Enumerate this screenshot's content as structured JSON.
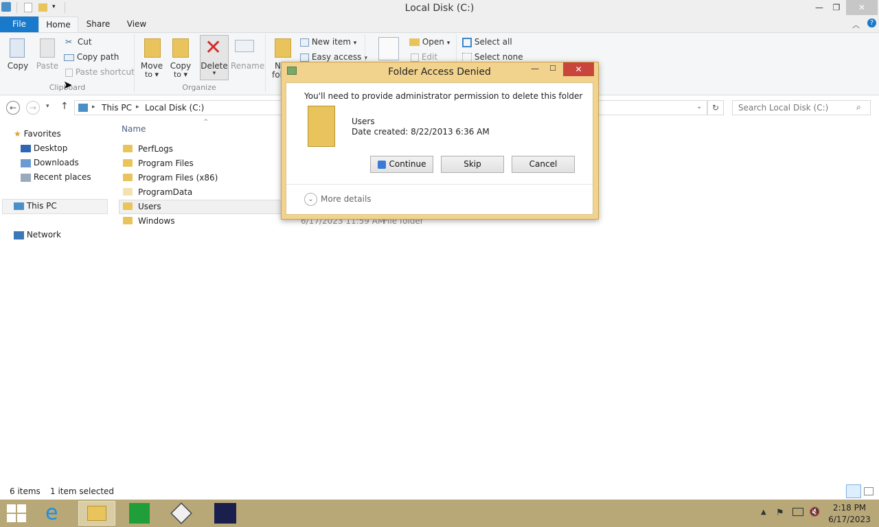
{
  "window": {
    "title": "Local Disk (C:)"
  },
  "tabs": [
    "File",
    "Home",
    "Share",
    "View"
  ],
  "ribbon": {
    "copy": "Copy",
    "paste": "Paste",
    "cut": "Cut",
    "copy_path": "Copy path",
    "paste_shortcut": "Paste shortcut",
    "clipboard_group": "Clipboard",
    "move_to": "Move",
    "move_to2": "to",
    "copy_to": "Copy",
    "copy_to2": "to",
    "delete": "Delete",
    "rename": "Rename",
    "organize_group": "Organize",
    "new_folder_a": "N",
    "new_folder_b": "fol",
    "new_item": "New item",
    "easy_access": "Easy access",
    "open": "Open",
    "edit": "Edit",
    "select_all": "Select all",
    "select_none": "Select none"
  },
  "address": {
    "segments": [
      "This PC",
      "Local Disk (C:)"
    ],
    "search_placeholder": "Search Local Disk (C:)"
  },
  "nav": {
    "favorites": "Favorites",
    "desktop": "Desktop",
    "downloads": "Downloads",
    "recent": "Recent places",
    "this_pc": "This PC",
    "network": "Network"
  },
  "list": {
    "header_name": "Name",
    "rows": [
      {
        "name": "PerfLogs"
      },
      {
        "name": "Program Files"
      },
      {
        "name": "Program Files (x86)"
      },
      {
        "name": "ProgramData"
      },
      {
        "name": "Users"
      },
      {
        "name": "Windows",
        "date": "6/17/2023 11:59 AM",
        "type": "File folder"
      }
    ]
  },
  "status": {
    "items": "6 items",
    "selected": "1 item selected"
  },
  "dialog": {
    "title": "Folder Access Denied",
    "message": "You'll need to provide administrator permission to delete this folder",
    "folder_name": "Users",
    "date_created": "Date created: 8/22/2013 6:36 AM",
    "continue": "Continue",
    "skip": "Skip",
    "cancel": "Cancel",
    "more_details": "More details"
  },
  "clock": {
    "time": "2:18 PM",
    "date": "6/17/2023"
  },
  "colors": {
    "file_tab": "#1979ca",
    "taskbar": "#b8a878",
    "dialog_frame": "#f2d38d"
  }
}
